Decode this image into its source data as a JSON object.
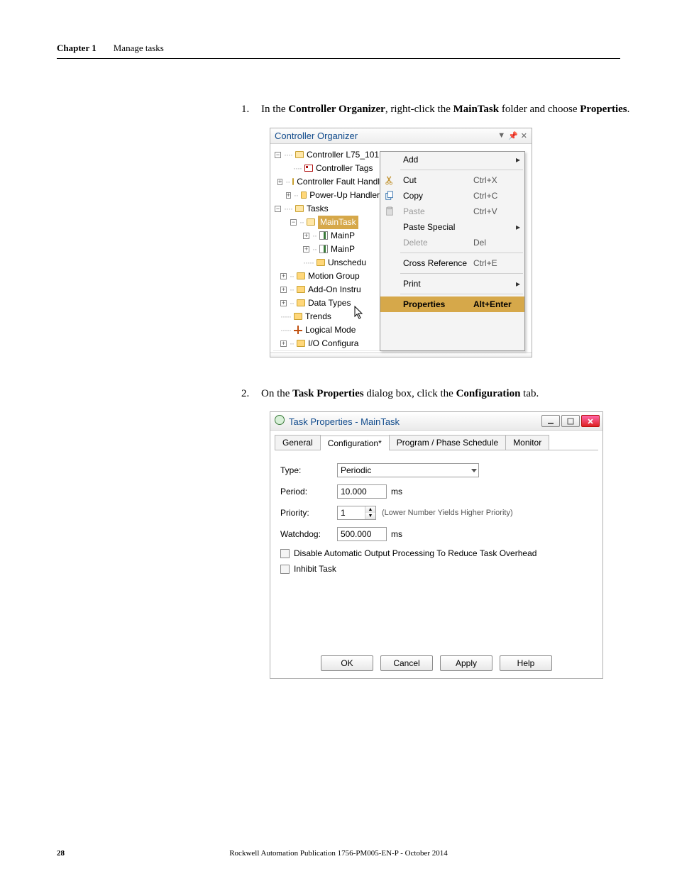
{
  "header": {
    "chapter": "Chapter 1",
    "section": "Manage tasks"
  },
  "steps": {
    "s1_num": "1.",
    "s1_a": "In the ",
    "s1_b": "Controller Organizer",
    "s1_c": ", right-click the ",
    "s1_d": "MainTask",
    "s1_e": " folder and choose ",
    "s1_f": "Properties",
    "s1_g": ".",
    "s2_num": "2.",
    "s2_a": "On the ",
    "s2_b": "Task Properties",
    "s2_c": " dialog box, click the ",
    "s2_d": "Configuration",
    "s2_e": " tab."
  },
  "co": {
    "title": "Controller Organizer",
    "tree": {
      "root": "Controller L75_101",
      "tags": "Controller Tags",
      "fault": "Controller Fault Handler",
      "power": "Power-Up Handler",
      "tasks": "Tasks",
      "maintask": "MainTask",
      "mp1": "MainP",
      "mp2": "MainP",
      "unsched": "Unschedu",
      "motion": "Motion Group",
      "addon": "Add-On Instru",
      "dt": "Data Types",
      "trends": "Trends",
      "logical": "Logical Mode",
      "io": "I/O Configura"
    },
    "menu": {
      "add": "Add",
      "cut": "Cut",
      "cut_sc": "Ctrl+X",
      "copy": "Copy",
      "copy_sc": "Ctrl+C",
      "paste": "Paste",
      "paste_sc": "Ctrl+V",
      "pspecial": "Paste Special",
      "delete": "Delete",
      "delete_sc": "Del",
      "xref": "Cross Reference",
      "xref_sc": "Ctrl+E",
      "print": "Print",
      "props": "Properties",
      "props_sc": "Alt+Enter"
    }
  },
  "tp": {
    "title": "Task Properties - MainTask",
    "tabs": {
      "general": "General",
      "config": "Configuration*",
      "sched": "Program / Phase Schedule",
      "mon": "Monitor"
    },
    "labels": {
      "type": "Type:",
      "period": "Period:",
      "priority": "Priority:",
      "wdog": "Watchdog:"
    },
    "values": {
      "type": "Periodic",
      "period": "10.000",
      "priority": "1",
      "wdog": "500.000"
    },
    "units": "ms",
    "hint": "(Lower Number Yields Higher Priority)",
    "check1": "Disable Automatic Output Processing To Reduce Task Overhead",
    "check2": "Inhibit Task",
    "buttons": {
      "ok": "OK",
      "cancel": "Cancel",
      "apply": "Apply",
      "help": "Help"
    }
  },
  "footer": {
    "page": "28",
    "pub": "Rockwell Automation Publication 1756-PM005-EN-P - October 2014"
  }
}
